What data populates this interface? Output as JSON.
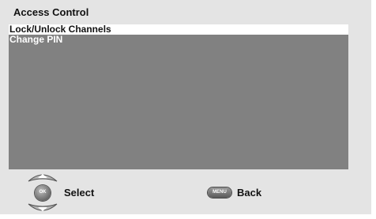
{
  "header": {
    "title": "Access Control"
  },
  "menu": {
    "items": [
      {
        "label": "Lock/Unlock Channels",
        "selected": true
      },
      {
        "label": "Change PIN",
        "selected": false
      }
    ]
  },
  "footer": {
    "ok_button_text": "OK",
    "select_label": "Select",
    "menu_button_text": "MENU",
    "back_label": "Back"
  },
  "colors": {
    "screen_background": "#e4e4e4",
    "menu_panel": "#818181",
    "selection_highlight": "#ffffff"
  }
}
